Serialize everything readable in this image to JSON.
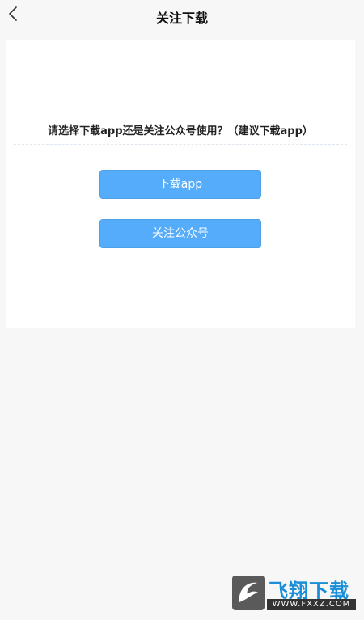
{
  "navbar": {
    "back_icon": "chevron-left-icon",
    "title": "关注下载"
  },
  "card": {
    "question": "请选择下载app还是关注公众号使用？（建议下载app）",
    "download_button": "下载app",
    "follow_button": "关注公众号"
  },
  "watermark": {
    "name": "飞翔下载",
    "url": "WWW.FXXZ.COM"
  },
  "colors": {
    "page_bg": "#f7f7f7",
    "card_bg": "#ffffff",
    "button_bg": "#55acfb",
    "watermark_blue": "#1a8fd8"
  }
}
